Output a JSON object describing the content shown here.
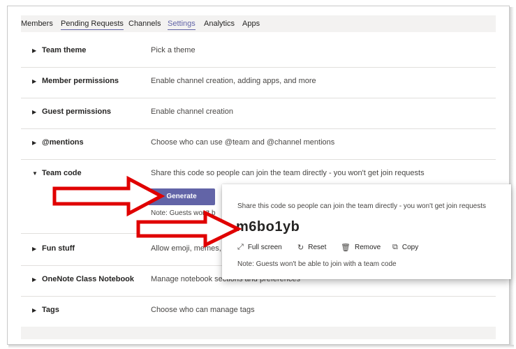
{
  "tabs": [
    {
      "label": "Members"
    },
    {
      "label": "Pending Requests"
    },
    {
      "label": "Channels"
    },
    {
      "label": "Settings"
    },
    {
      "label": "Analytics"
    },
    {
      "label": "Apps"
    }
  ],
  "settings": [
    {
      "title": "Team theme",
      "desc": "Pick a theme"
    },
    {
      "title": "Member permissions",
      "desc": "Enable channel creation, adding apps, and more"
    },
    {
      "title": "Guest permissions",
      "desc": "Enable channel creation"
    },
    {
      "title": "@mentions",
      "desc": "Choose who can use @team and @channel mentions"
    },
    {
      "title": "Team code",
      "desc": "Share this code so people can join the team directly - you won't get join requests"
    },
    {
      "title": "Fun stuff",
      "desc": "Allow emoji, memes, G"
    },
    {
      "title": "OneNote Class Notebook",
      "desc": "Manage notebook sections and preferences"
    },
    {
      "title": "Tags",
      "desc": "Choose who can manage tags"
    }
  ],
  "team_code": {
    "generate_label": "Generate",
    "note_partial": "Note: Guests won't b"
  },
  "popup": {
    "desc": "Share this code so people can join the team directly - you won't get join requests",
    "code": "m6bo1yb",
    "actions": [
      {
        "label": "Full screen",
        "icon": "expand-icon"
      },
      {
        "label": "Reset",
        "icon": "reset-icon"
      },
      {
        "label": "Remove",
        "icon": "trash-icon"
      },
      {
        "label": "Copy",
        "icon": "copy-icon"
      }
    ],
    "note": "Note: Guests won't be able to join with a team code"
  },
  "colors": {
    "accent": "#6264a7",
    "annotation_arrow": "#e00000"
  }
}
